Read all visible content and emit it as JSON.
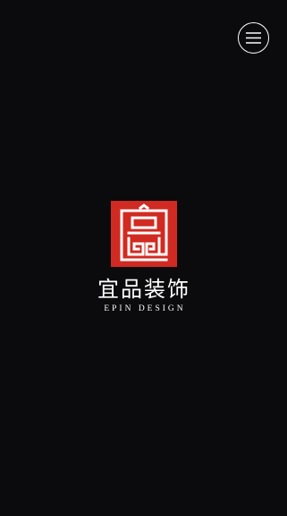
{
  "header": {
    "menu_icon": "hamburger-menu-icon"
  },
  "logo": {
    "seal_icon": "epin-seal-logo",
    "brand_cn": "宜品装饰",
    "brand_en": "EPIN DESIGN",
    "seal_color": "#d12a22"
  },
  "colors": {
    "background": "#0b0b0e",
    "foreground": "#ffffff"
  }
}
